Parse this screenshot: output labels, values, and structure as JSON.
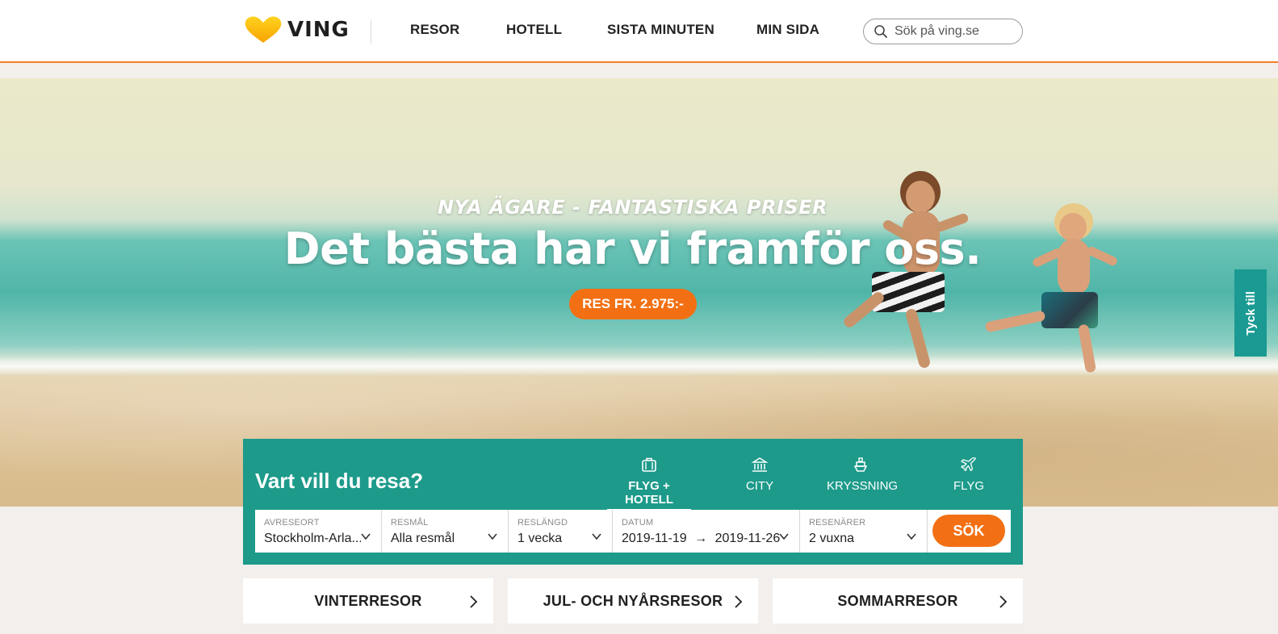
{
  "header": {
    "logo_text": "VING",
    "nav": [
      "RESOR",
      "HOTELL",
      "SISTA MINUTEN",
      "MIN SIDA"
    ],
    "search_placeholder": "Sök på ving.se"
  },
  "hero": {
    "kicker": "NYA ÄGARE - FANTASTISKA PRISER",
    "title": "Det bästa har vi framför oss.",
    "cta": "RES FR. 2.975:-"
  },
  "feedback_tab": "Tyck till",
  "search_panel": {
    "title": "Vart vill du resa?",
    "tabs": [
      {
        "label": "FLYG + HOTELL",
        "icon": "suitcase-icon",
        "active": true
      },
      {
        "label": "CITY",
        "icon": "building-icon",
        "active": false
      },
      {
        "label": "KRYSSNING",
        "icon": "ship-icon",
        "active": false
      },
      {
        "label": "FLYG",
        "icon": "plane-icon",
        "active": false
      }
    ],
    "fields": {
      "departure": {
        "label": "AVRESEORT",
        "value": "Stockholm-Arla..."
      },
      "destination": {
        "label": "RESMÅL",
        "value": "Alla resmål"
      },
      "duration": {
        "label": "RESLÄNGD",
        "value": "1 vecka"
      },
      "dates": {
        "label": "DATUM",
        "from": "2019-11-19",
        "arrow": "→",
        "to": "2019-11-26"
      },
      "travelers": {
        "label": "RESENÄRER",
        "value": "2 vuxna"
      }
    },
    "submit": "SÖK"
  },
  "categories": [
    "VINTERRESOR",
    "JUL- OCH NYÅRSRESOR",
    "SOMMARRESOR"
  ],
  "colors": {
    "accent_orange": "#f27013",
    "panel_teal": "#1d9a8a",
    "feedback_teal": "#1a9a92",
    "header_border": "#f57f26"
  }
}
